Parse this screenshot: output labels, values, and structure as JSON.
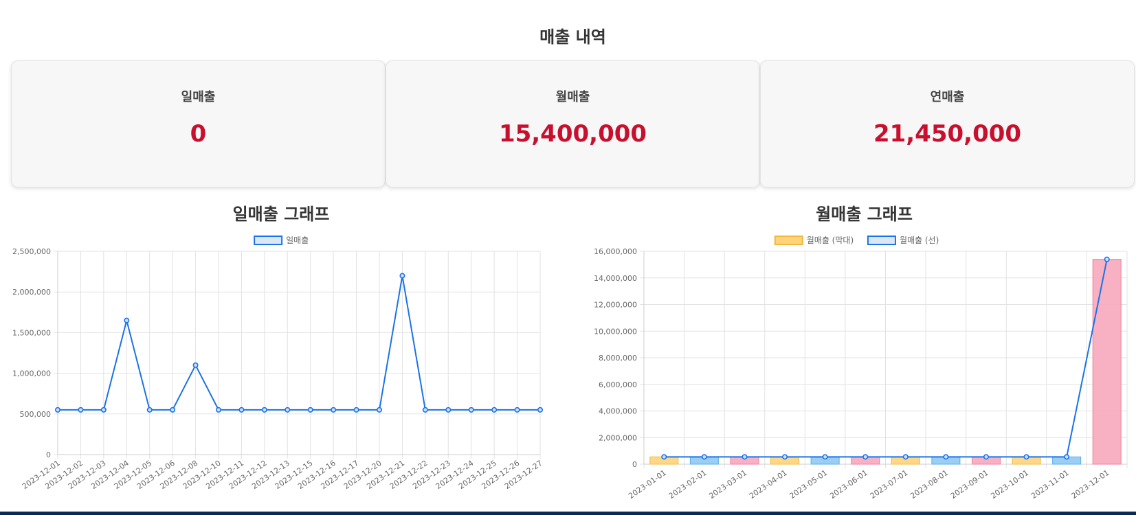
{
  "page": {
    "title": "매출 내역"
  },
  "cards": [
    {
      "label": "일매출",
      "value": "0"
    },
    {
      "label": "월매출",
      "value": "15,400,000"
    },
    {
      "label": "연매출",
      "value": "21,450,000"
    }
  ],
  "colors": {
    "line": "#1a73e8",
    "value_red": "#c8102e",
    "bar_yellow": "#ffd37a",
    "bar_blue": "#90c9f2",
    "bar_pink": "#f7a8bb",
    "grid": "#e2e2e2"
  },
  "chart_data": [
    {
      "type": "line",
      "title": "일매출 그래프",
      "legend_position": "top",
      "categories": [
        "2023-12-01",
        "2023-12-02",
        "2023-12-03",
        "2023-12-04",
        "2023-12-05",
        "2023-12-06",
        "2023-12-08",
        "2023-12-10",
        "2023-12-11",
        "2023-12-12",
        "2023-12-13",
        "2023-12-15",
        "2023-12-16",
        "2023-12-17",
        "2023-12-20",
        "2023-12-21",
        "2023-12-22",
        "2023-12-23",
        "2023-12-24",
        "2023-12-25",
        "2023-12-26",
        "2023-12-27"
      ],
      "series": [
        {
          "name": "일매출",
          "values": [
            550000,
            550000,
            550000,
            1650000,
            550000,
            550000,
            1100000,
            550000,
            550000,
            550000,
            550000,
            550000,
            550000,
            550000,
            550000,
            2200000,
            550000,
            550000,
            550000,
            550000,
            550000,
            550000
          ]
        }
      ],
      "ylim": [
        0,
        2500000
      ],
      "yticks": [
        "2,500,000",
        "2,000,000",
        "1,500,000",
        "1,000,000",
        "500,000",
        "0"
      ],
      "grid": true
    },
    {
      "type": "bar",
      "title": "월매출 그래프",
      "legend_position": "top",
      "categories": [
        "2023-01-01",
        "2023-02-01",
        "2023-03-01",
        "2023-04-01",
        "2023-05-01",
        "2023-06-01",
        "2023-07-01",
        "2023-08-01",
        "2023-09-01",
        "2023-10-01",
        "2023-11-01",
        "2023-12-01"
      ],
      "series": [
        {
          "name": "월매출 (막대)",
          "type": "bar",
          "values": [
            550000,
            550000,
            550000,
            550000,
            550000,
            550000,
            550000,
            550000,
            550000,
            550000,
            550000,
            15400000
          ]
        },
        {
          "name": "월매출 (선)",
          "type": "line",
          "values": [
            550000,
            550000,
            550000,
            550000,
            550000,
            550000,
            550000,
            550000,
            550000,
            550000,
            550000,
            15400000
          ]
        }
      ],
      "ylim": [
        0,
        16000000
      ],
      "yticks": [
        "16,000,000",
        "14,000,000",
        "12,000,000",
        "10,000,000",
        "8,000,000",
        "6,000,000",
        "4,000,000",
        "2,000,000",
        "0"
      ],
      "grid": true
    }
  ]
}
